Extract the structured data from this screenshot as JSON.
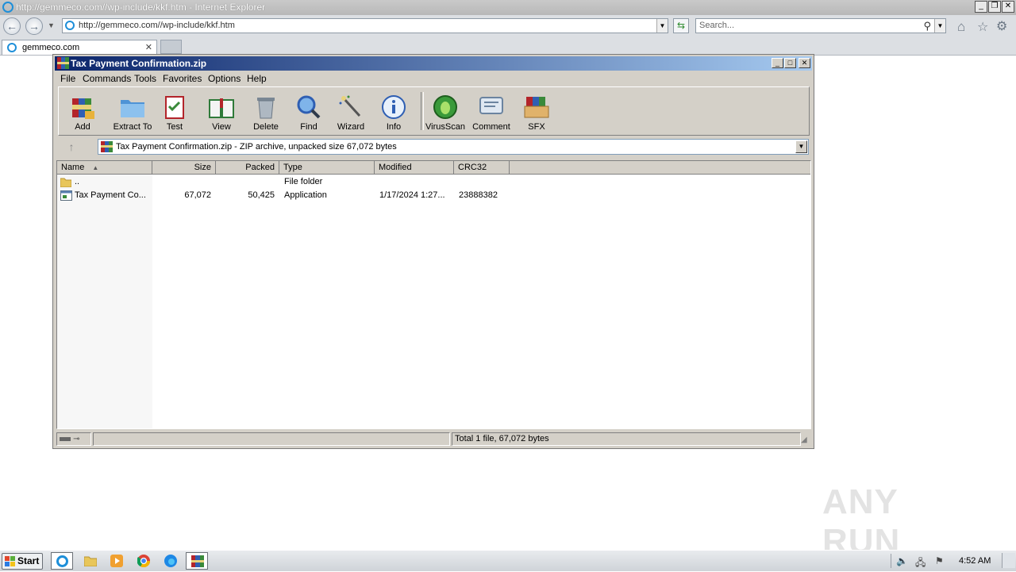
{
  "browser": {
    "title": "http://gemmeco.com//wp-include/kkf.htm - Internet Explorer",
    "address_url": "http://gemmeco.com//wp-include/kkf.htm",
    "search_placeholder": "Search...",
    "tab_label": "gemmeco.com"
  },
  "winrar": {
    "title": "Tax Payment Confirmation.zip",
    "menu": [
      "File",
      "Commands",
      "Tools",
      "Favorites",
      "Options",
      "Help"
    ],
    "toolbar": [
      "Add",
      "Extract To",
      "Test",
      "View",
      "Delete",
      "Find",
      "Wizard",
      "Info",
      "VirusScan",
      "Comment",
      "SFX"
    ],
    "path_text": "Tax Payment Confirmation.zip - ZIP archive, unpacked size 67,072 bytes",
    "columns": [
      "Name",
      "Size",
      "Packed",
      "Type",
      "Modified",
      "CRC32"
    ],
    "rows": [
      {
        "name": "..",
        "size": "",
        "packed": "",
        "type": "File folder",
        "modified": "",
        "crc": ""
      },
      {
        "name": "Tax Payment Co...",
        "size": "67,072",
        "packed": "50,425",
        "type": "Application",
        "modified": "1/17/2024 1:27...",
        "crc": "23888382"
      }
    ],
    "status_text": "Total 1 file, 67,072 bytes"
  },
  "watermark": "ANY RUN",
  "taskbar": {
    "start_label": "Start",
    "clock": "4:52 AM"
  },
  "colors": {
    "rar_title_start": "#0a246a",
    "rar_title_end": "#a6caf0",
    "ie_logo": "#1e8fd9"
  }
}
